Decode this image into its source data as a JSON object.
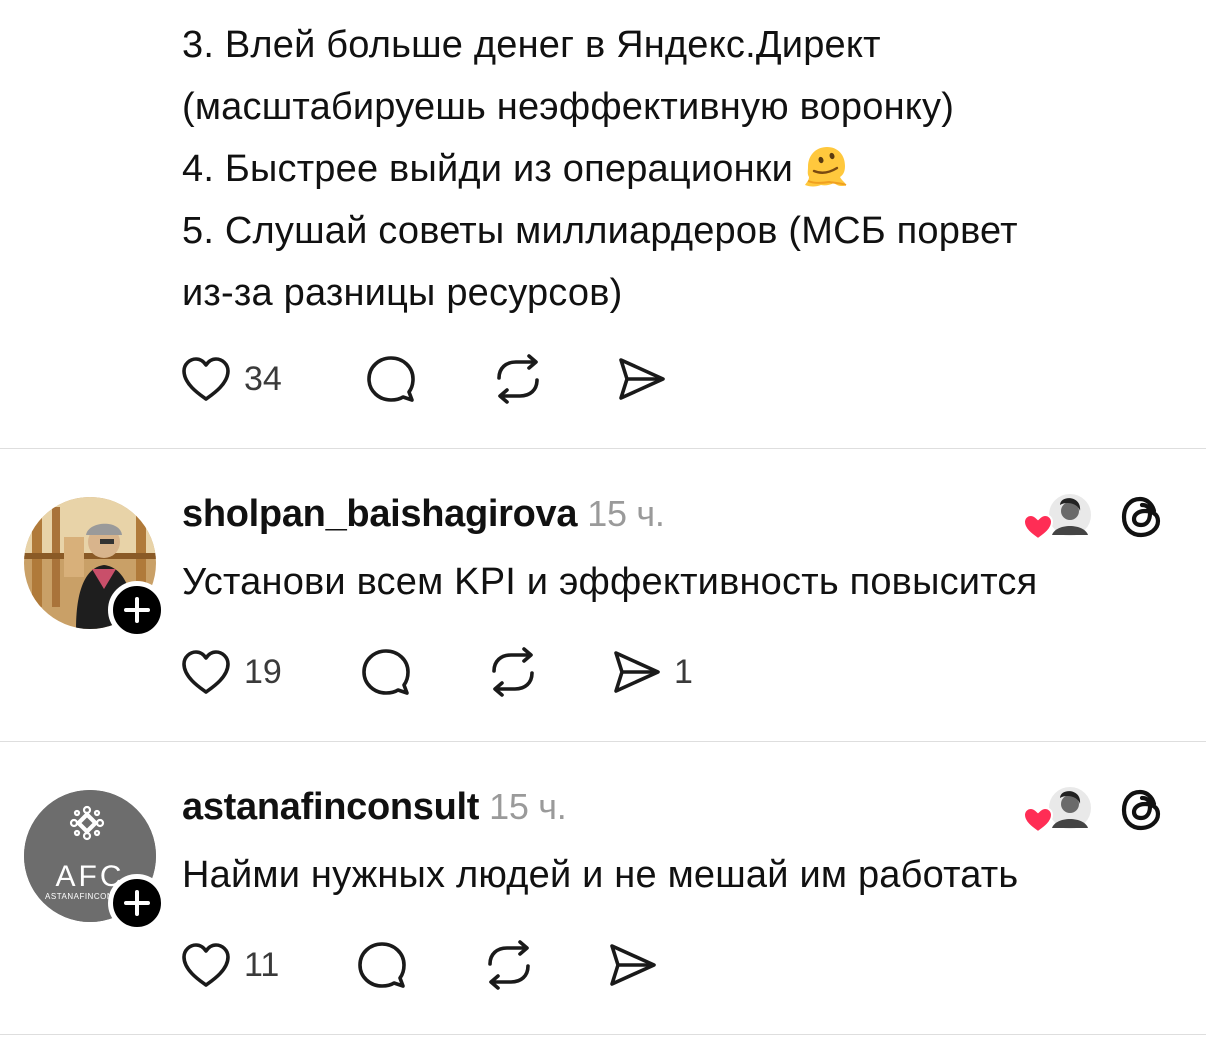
{
  "post": {
    "lines": [
      "3. Влей больше денег в Яндекс.Директ",
      "(масштабируешь неэффективную воронку)",
      "4. Быстрее выйди из операционки",
      "5. Слушай советы миллиардеров (МСБ порвет",
      "из-за разницы ресурсов)"
    ],
    "emoji": "melting-face-emoji",
    "likes": "34",
    "comments": "",
    "reposts": "",
    "shares": ""
  },
  "replies": [
    {
      "username": "sholpan_baishagirova",
      "time": "15 ч.",
      "text": "Установи всем KPI и эффективность повысится",
      "likes": "19",
      "comments": "",
      "reposts": "",
      "shares": "1",
      "avatar": "photo-avatar"
    },
    {
      "username": "astanafinconsult",
      "time": "15 ч.",
      "text": "Найми нужных людей и не мешай им работать",
      "likes": "11",
      "comments": "",
      "reposts": "",
      "shares": "",
      "avatar": "logo-avatar",
      "logo_text": "AFC",
      "logo_subtext": "ASTANAFINCONSULT"
    }
  ],
  "colors": {
    "text": "#111111",
    "muted": "#9a9a9a",
    "heart_red": "#ff2d55",
    "divider": "#dedede",
    "afc_bg": "#6d6d6d"
  }
}
